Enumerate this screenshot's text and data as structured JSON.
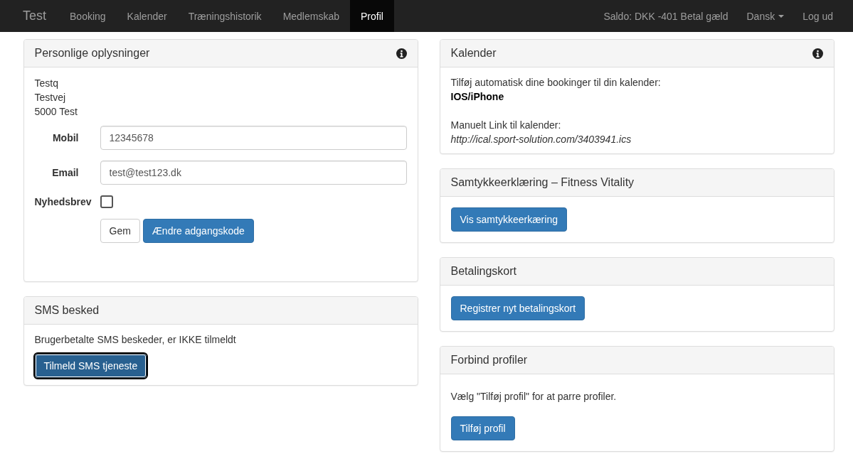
{
  "navbar": {
    "brand": "Test",
    "items": [
      {
        "label": "Booking",
        "selected": false
      },
      {
        "label": "Kalender",
        "selected": false
      },
      {
        "label": "Træningshistorik",
        "selected": false
      },
      {
        "label": "Medlemskab",
        "selected": false
      },
      {
        "label": "Profil",
        "selected": true
      }
    ],
    "balance": "Saldo: DKK -401 Betal gæld",
    "language": "Dansk",
    "logout": "Log ud"
  },
  "personal": {
    "title": "Personlige oplysninger",
    "address": [
      "Testq",
      "Testvej",
      "5000 Test"
    ],
    "fields": [
      {
        "kind": "text",
        "label": "Mobil",
        "value": "12345678"
      },
      {
        "kind": "text",
        "label": "Email",
        "value": "test@test123.dk"
      },
      {
        "kind": "checkbox",
        "label": "Nyhedsbrev",
        "checked": false
      }
    ],
    "buttons": [
      {
        "label": "Gem",
        "kind": "default"
      },
      {
        "label": "Ændre adgangskode",
        "kind": "primary"
      }
    ]
  },
  "sms": {
    "title": "SMS besked",
    "text": "Brugerbetalte SMS beskeder, er IKKE tilmeldt",
    "button": {
      "label": "Tilmeld SMS tjeneste",
      "focused": true
    }
  },
  "calendar": {
    "title": "Kalender",
    "intro": "Tilføj automatisk dine bookinger til din kalender:",
    "ios_link": "IOS/iPhone",
    "manual_label": "Manuelt Link til kalender:",
    "url": "http://ical.sport-solution.com/3403941.ics"
  },
  "consent": {
    "title": "Samtykkeerklæring – Fitness Vitality",
    "button": "Vis samtykkeerkæring"
  },
  "payment": {
    "title": "Betalingskort",
    "button": "Registrer nyt betalingskort"
  },
  "connect": {
    "title": "Forbind profiler",
    "text": "Vælg \"Tilføj profil\" for at parre profiler.",
    "button": "Tilføj profil"
  }
}
